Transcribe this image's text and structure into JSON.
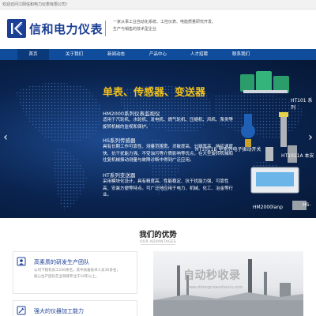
{
  "topbar": {
    "welcome": "欢迎访问江阴信和电力仪表有限公司！"
  },
  "header": {
    "brand": "信和电力仪表",
    "slogan_line1": "一家从事工业自动化系统、工控仪表、电能质量研究开发、",
    "slogan_line2": "生产与销售的技术型企业"
  },
  "nav": {
    "items": [
      {
        "label": "首页"
      },
      {
        "label": "关于我们"
      },
      {
        "label": "新闻动态"
      },
      {
        "label": "产品中心"
      },
      {
        "label": "人才招聘"
      },
      {
        "label": "联系我们"
      }
    ]
  },
  "banner": {
    "title": "单表、传感器、变送器",
    "hm_head": "HM2000系列仪表监视仪",
    "hm_desc": "适用于汽轮机、水轮机、发电机、燃气轮机、压缩机、风机、泵类等旋转机械的监视和保护。",
    "hs_head": "HS系列传感器",
    "hs_desc": "具有长期工作可靠性、测量范围宽、灵敏度高、分辨率高、响应速度快、抗干扰能力强、不受油污等介质影响等优点，在大型旋转机械和往复机械振动测量与故障诊断中得到广泛应用。",
    "ht_head": "HT系列变送器",
    "ht_desc": "采用模块化设计，具有精度高、性能稳定、抗干扰能力强、可靠性高、安装方便等特点。可广泛地应用于电力、机械、化工、冶金等行业。",
    "device_labels": {
      "d1": "HT101 系列",
      "d2": "HT1011A 本安",
      "d3": "HT1011B 型系列电子振动开关",
      "d4": "HM2000lanp",
      "d5": "HS-"
    }
  },
  "advantages": {
    "title": "我们的优势",
    "subtitle": "OUR ADVANTAGES",
    "cards": [
      {
        "title": "高素质的研发生产团队",
        "desc_line1": "公司下辖有员工100余名，其中具备技术人员30多名；",
        "desc_line2": "核心生产团队在业领域专注于10年以上。"
      },
      {
        "title": "强大的仪器加工能力",
        "desc_line1": "",
        "desc_line2": ""
      }
    ]
  },
  "watermark": {
    "main": "自动秒收录",
    "sub": "www.zidongmiaoshoulu.com"
  },
  "colors": {
    "brand_blue": "#1b3f95",
    "nav_blue": "#0f4d9c",
    "accent_yellow": "#f4c21b"
  }
}
